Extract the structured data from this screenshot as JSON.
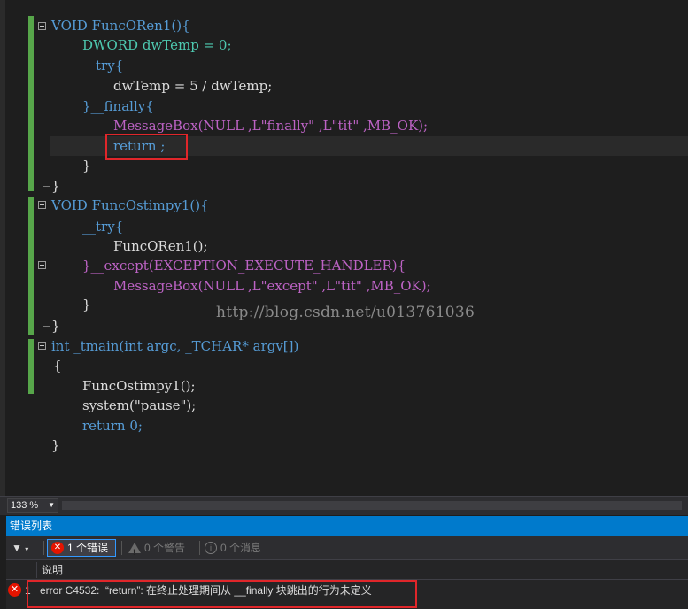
{
  "editor": {
    "lines": [
      "VOID FuncORen1(){",
      "DWORD dwTemp = 0;",
      "__try{",
      "dwTemp = 5 / dwTemp;",
      "}__finally{",
      "MessageBox(NULL ,L\"finally\" ,L\"tit\" ,MB_OK);",
      "return ;",
      "}",
      "}",
      "VOID FuncOstimpy1(){",
      "__try{",
      "FuncORen1();",
      "}__except(EXCEPTION_EXECUTE_HANDLER){",
      "MessageBox(NULL ,L\"except\" ,L\"tit\" ,MB_OK);",
      "}",
      "}",
      "int _tmain(int argc, _TCHAR* argv[])",
      "{",
      "FuncOstimpy1();",
      "system(\"pause\");",
      "return 0;",
      "}"
    ],
    "watermark": "http://blog.csdn.net/u013761036"
  },
  "zoom": {
    "level": "133 %"
  },
  "error_list": {
    "title": "错误列表",
    "filter_icon": "funnel-icon",
    "errors_toggle": "1 个错误",
    "warnings_toggle": "0 个警告",
    "messages_toggle": "0 个消息",
    "column_description": "说明",
    "rows": [
      {
        "num": "1",
        "text": "error C4532:  “return”: 在终止处理期间从 __finally 块跳出的行为未定义"
      }
    ]
  },
  "colors": {
    "keyword": "#569cd6",
    "type": "#4ec9b0",
    "macro": "#bd63c5",
    "string": "#d69d85",
    "highlight_box": "#e0262a",
    "panel_title": "#007acc",
    "error_icon": "#e51400"
  }
}
